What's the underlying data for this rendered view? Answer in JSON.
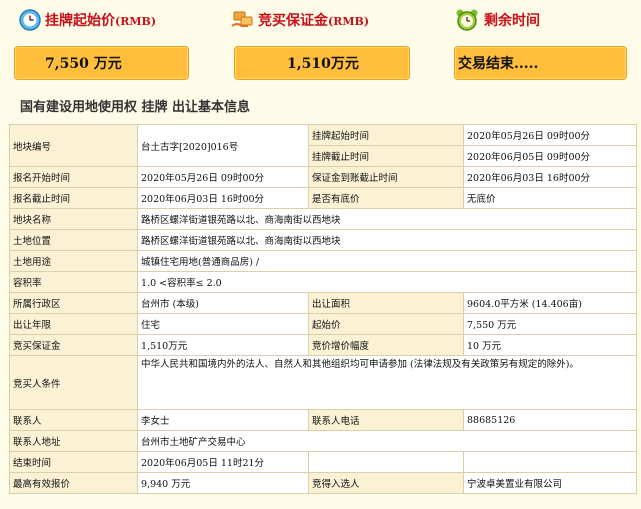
{
  "header": {
    "start_price_label": "挂牌起始价",
    "start_price_unit": "(RMB)",
    "start_price_value": "7,550 万元",
    "deposit_label": "竞买保证金",
    "deposit_unit": "(RMB)",
    "deposit_value": "1,510万元",
    "remaining_label": "剩余时间",
    "remaining_value": "交易结束.....",
    "icons": [
      "clock-icon",
      "hands-money-icon",
      "alarm-clock-icon"
    ],
    "colors": {
      "label_red": "#c8101a",
      "box_orange": "#ffbf3c",
      "page_bg": "#fffbe9"
    }
  },
  "section_title": "国有建设用地使用权 挂牌 出让基本信息",
  "table": {
    "parcel_no_label": "地块编号",
    "parcel_no": "台土古字[2020]016号",
    "listing_start_label": "挂牌起始时间",
    "listing_start": "2020年05月26日 09时00分",
    "listing_end_label": "挂牌截止时间",
    "listing_end": "2020年06月05日 09时00分",
    "signup_start_label": "报名开始时间",
    "signup_start": "2020年05月26日 09时00分",
    "deposit_deadline_label": "保证金到账截止时间",
    "deposit_deadline": "2020年06月03日 16时00分",
    "signup_end_label": "报名截止时间",
    "signup_end": "2020年06月03日 16时00分",
    "reserve_label": "是否有底价",
    "reserve": "无底价",
    "name_label": "地块名称",
    "name": "路桥区螺洋街道银苑路以北、商海南街以西地块",
    "location_label": "土地位置",
    "location": "路桥区螺洋街道银苑路以北、商海南街以西地块",
    "usage_label": "土地用途",
    "usage": "城镇住宅用地(普通商品房) /",
    "far_label": "容积率",
    "far": "1.0 <容积率≤ 2.0",
    "district_label": "所属行政区",
    "district": "台州市 (本级)",
    "area_label": "出让面积",
    "area": "9604.0平方米 (14.406亩)",
    "term_label": "出让年限",
    "term": "住宅",
    "start_price_label": "起始价",
    "start_price": "7,550 万元",
    "bid_deposit_label": "竞买保证金",
    "bid_deposit": "1,510万元",
    "increment_label": "竞价增价幅度",
    "increment": "10 万元",
    "conditions_label": "竞买人条件",
    "conditions": "中华人民共和国境内外的法人、自然人和其他组织均可申请参加 (法律法规及有关政策另有规定的除外)。",
    "contact_label": "联系人",
    "contact": "李女士",
    "phone_label": "联系人电话",
    "phone": "88685126",
    "address_label": "联系人地址",
    "address": "台州市土地矿产交易中心",
    "end_time_label": "结束时间",
    "end_time": "2020年06月05日 11时21分",
    "top_bid_label": "最高有效报价",
    "top_bid": "9,940 万元",
    "winner_label": "竞得入选人",
    "winner": "宁波卓美置业有限公司"
  }
}
